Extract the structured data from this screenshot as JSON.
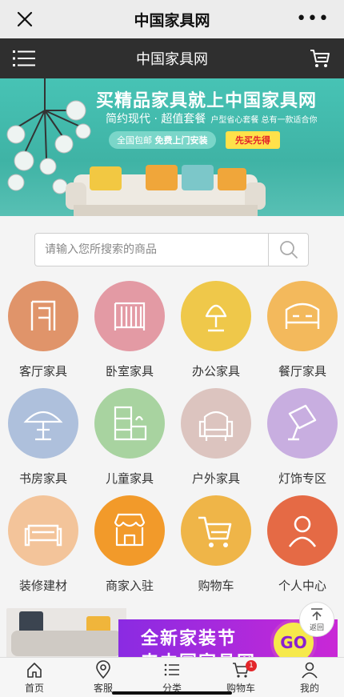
{
  "window": {
    "title": "中国家具网",
    "more": "•••"
  },
  "header": {
    "title": "中国家具网"
  },
  "banner": {
    "headline": "买精品家具就上中国家具网",
    "sub": "简约现代 · 超值套餐",
    "sub_small": "户型省心套餐 总有一款适合你",
    "pill_prefix": "全国包邮",
    "pill_bold": "免费上门安装",
    "buy_label": "先买先得"
  },
  "search": {
    "placeholder": "请输入您所搜索的商品"
  },
  "categories": [
    {
      "label": "客厅家具",
      "color": "#e0946a",
      "icon": "door-frame-icon"
    },
    {
      "label": "卧室家具",
      "color": "#e39aa4",
      "icon": "crib-icon"
    },
    {
      "label": "办公家具",
      "color": "#efc84a",
      "icon": "lamp-icon"
    },
    {
      "label": "餐厅家具",
      "color": "#f3b95c",
      "icon": "bed-icon"
    },
    {
      "label": "书房家具",
      "color": "#aec0dc",
      "icon": "umbrella-icon"
    },
    {
      "label": "儿童家具",
      "color": "#a8d3a0",
      "icon": "shelf-icon"
    },
    {
      "label": "户外家具",
      "color": "#dcc4bf",
      "icon": "armchair-icon"
    },
    {
      "label": "灯饰专区",
      "color": "#c8aee0",
      "icon": "roller-icon"
    },
    {
      "label": "装修建材",
      "color": "#f3c49a",
      "icon": "sofa-icon"
    },
    {
      "label": "商家入驻",
      "color": "#f29a2a",
      "icon": "store-icon"
    },
    {
      "label": "购物车",
      "color": "#efb548",
      "icon": "cart-icon"
    },
    {
      "label": "个人中心",
      "color": "#e56a45",
      "icon": "person-icon"
    }
  ],
  "promo": {
    "line1": "全新家装节",
    "line2": "来中国家具网",
    "go": "GO"
  },
  "backtop": {
    "label": "返回"
  },
  "tabs": [
    {
      "label": "首页",
      "icon": "home-icon"
    },
    {
      "label": "客服",
      "icon": "location-icon"
    },
    {
      "label": "分类",
      "icon": "list-icon"
    },
    {
      "label": "购物车",
      "icon": "cart-icon",
      "badge": "1"
    },
    {
      "label": "我的",
      "icon": "user-icon"
    }
  ]
}
